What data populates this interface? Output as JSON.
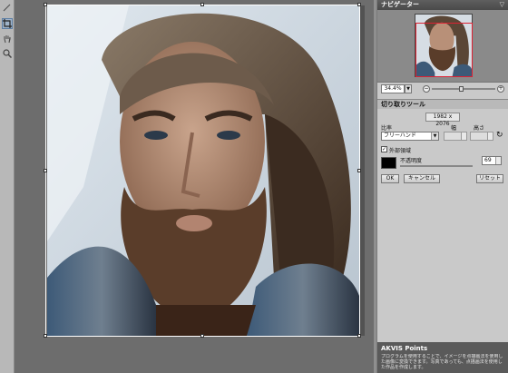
{
  "panel": {
    "navigator_title": "ナビゲーター",
    "collapse_label": "▽",
    "zoom_value": "34.4%",
    "tool_title": "切り取りツール",
    "image_size": "1982 x 2076",
    "ratio_label": "比率",
    "width_label": "幅",
    "height_label": "高さ",
    "ratio_value": "フリーハンド",
    "outer_area_label": "外部領域",
    "opacity_label": "不透明度",
    "opacity_value": "69",
    "ok_label": "OK",
    "cancel_label": "キャンセル",
    "reset_label": "リセット"
  },
  "info": {
    "title": "AKVIS Points",
    "text": "プログラムを使用することで、イメージを点描画法を使用した画像に変換できます。写真であっても、点描画法を使用した作品を作成します。"
  },
  "colors": {
    "crop_outline": "#ffffff",
    "navigator_frame": "#dd2233",
    "panel_bg": "#c9c9c9"
  },
  "toolbar": {
    "tools": [
      "crop-icon",
      "hand-icon",
      "zoom-icon"
    ]
  }
}
